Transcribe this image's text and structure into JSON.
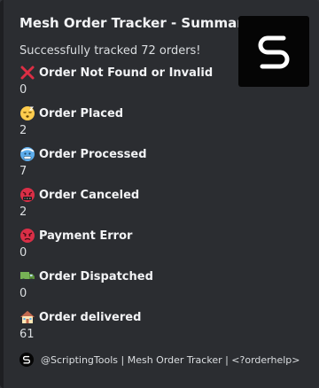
{
  "embed": {
    "title": "Mesh Order Tracker - Summary",
    "description": "Successfully tracked 72 orders!",
    "thumbnail_icon": "mesh-logo-icon",
    "fields": [
      {
        "icon": "red-cross-mark-icon",
        "name": "Order Not Found or Invalid",
        "value": "0"
      },
      {
        "icon": "sleepy-face-icon",
        "name": "Order Placed",
        "value": "2"
      },
      {
        "icon": "cold-face-icon",
        "name": "Order Processed",
        "value": "7"
      },
      {
        "icon": "cursing-face-icon",
        "name": "Order Canceled",
        "value": "2"
      },
      {
        "icon": "angry-face-icon",
        "name": "Payment Error",
        "value": "0"
      },
      {
        "icon": "delivery-truck-icon",
        "name": "Order Dispatched",
        "value": "0"
      },
      {
        "icon": "house-icon",
        "name": "Order delivered",
        "value": "61"
      }
    ],
    "footer": {
      "icon": "mesh-logo-icon",
      "text": "@ScriptingTools | Mesh Order Tracker | <?orderhelp>"
    }
  },
  "colors": {
    "background": "#313338",
    "embed_background": "#2b2d31",
    "text": "#dbdee1",
    "heading": "#f2f3f5"
  }
}
